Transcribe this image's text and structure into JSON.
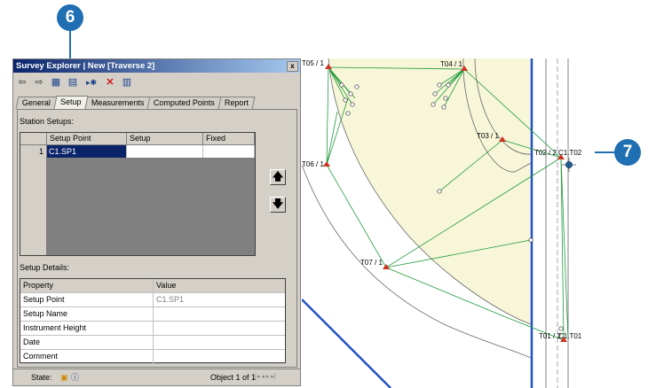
{
  "callouts": {
    "c6": "6",
    "c7": "7"
  },
  "window": {
    "title": "Survey Explorer | New [Traverse 2]",
    "close_glyph": "x"
  },
  "toolbar": [
    "back-arrow-icon",
    "forward-arrow-icon",
    "table-icon",
    "grid-icon",
    "add-setup-icon",
    "delete-icon",
    "report-icon"
  ],
  "tabs": [
    {
      "label": "General",
      "active": false
    },
    {
      "label": "Setup",
      "active": true
    },
    {
      "label": "Measurements",
      "active": false
    },
    {
      "label": "Computed Points",
      "active": false
    },
    {
      "label": "Report",
      "active": false
    }
  ],
  "station_setups": {
    "label": "Station Setups:",
    "columns": [
      "Setup Point",
      "Setup",
      "Fixed"
    ],
    "rows": [
      {
        "num": "1",
        "setup_point": "C1.SP1",
        "setup": "",
        "fixed": ""
      }
    ]
  },
  "setup_details": {
    "label": "Setup Details:",
    "columns": [
      "Property",
      "Value"
    ],
    "rows": [
      {
        "property": "Setup Point",
        "value": "C1.SP1"
      },
      {
        "property": "Setup Name",
        "value": ""
      },
      {
        "property": "Instrument Height",
        "value": ""
      },
      {
        "property": "Date",
        "value": ""
      },
      {
        "property": "Comment",
        "value": ""
      }
    ]
  },
  "status": {
    "state_label": "State:",
    "object_text": "Object 1 of 1",
    "nav_glyphs": "|◂ ◂ ▸ ▸|"
  },
  "map": {
    "labels": [
      "T05 / 1",
      "T04 / 1",
      "T03 / 1",
      "T02 / 2",
      "C1.T02",
      "T06 / 1",
      "T07 / 1",
      "T01 / 2",
      "C1.T01"
    ],
    "colors": {
      "parcel_fill": "#f7f6d9",
      "lines": "#1f9a3a",
      "road": "#2352c4",
      "point": "#cc3322"
    }
  }
}
